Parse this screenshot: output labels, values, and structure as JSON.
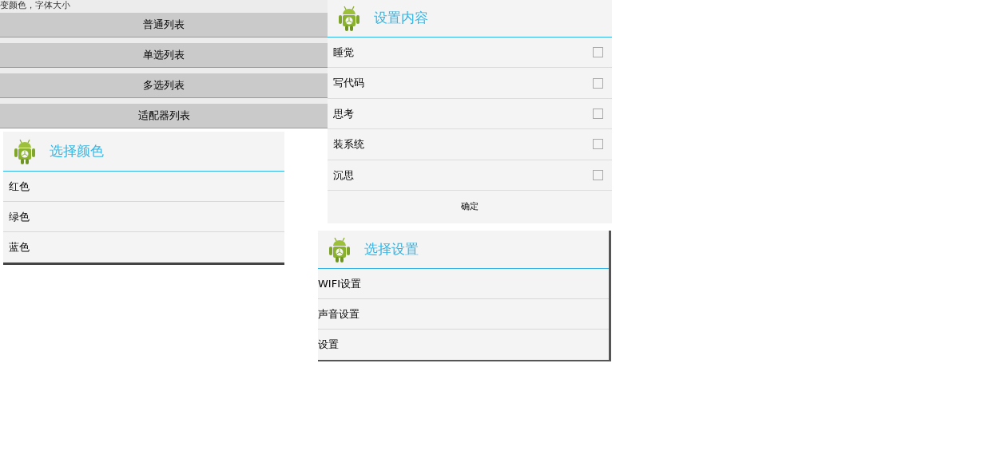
{
  "main_screen": {
    "hint": "变颜色，字体大小",
    "buttons": [
      "普通列表",
      "单选列表",
      "多选列表",
      "适配器列表"
    ]
  },
  "color_dialog": {
    "title": "选择颜色",
    "items": [
      "红色",
      "绿色",
      "蓝色"
    ]
  },
  "multi_choice_dialog": {
    "title": "设置内容",
    "items": [
      {
        "label": "睡觉",
        "checked": false
      },
      {
        "label": "写代码",
        "checked": false
      },
      {
        "label": "思考",
        "checked": false
      },
      {
        "label": "装系统",
        "checked": false
      },
      {
        "label": "沉思",
        "checked": false
      }
    ],
    "button": "确定"
  },
  "settings_dialog": {
    "title": "选择设置",
    "items": [
      "WIFI设置",
      "声音设置",
      "设置"
    ]
  }
}
